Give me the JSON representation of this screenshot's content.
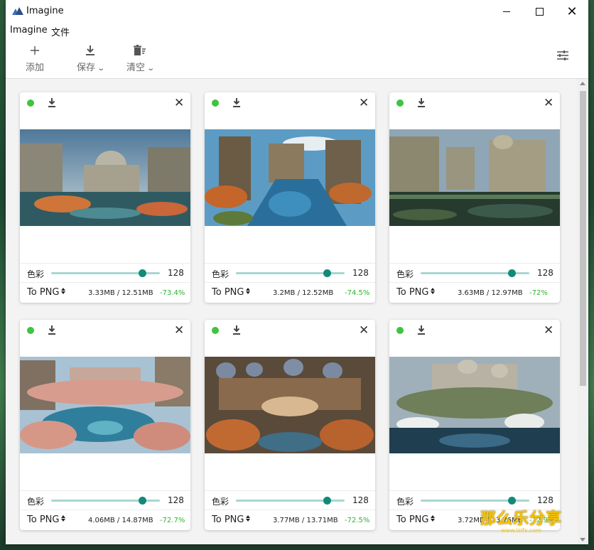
{
  "window": {
    "title": "Imagine"
  },
  "menu": [
    "Imagine",
    "文件"
  ],
  "toolbar": {
    "add_label": "添加",
    "save_label": "保存",
    "clear_label": "清空",
    "icons": {
      "add": "plus-icon",
      "save": "download-icon",
      "clear": "delete-list-icon",
      "settings": "sliders-icon"
    }
  },
  "colors": {
    "accent": "#128a78",
    "slider_track": "#a8d6d0",
    "status_dot": "#3ec43e",
    "saving": "#2fb52f"
  },
  "cards": [
    {
      "quality_label": "色彩",
      "quality_value": "128",
      "format": "To PNG",
      "size": "3.33MB / 12.51MB",
      "saving": "-73.4%",
      "slider_fraction": 0.84
    },
    {
      "quality_label": "色彩",
      "quality_value": "128",
      "format": "To PNG",
      "size": "3.2MB / 12.52MB",
      "saving": "-74.5%",
      "slider_fraction": 0.84
    },
    {
      "quality_label": "色彩",
      "quality_value": "128",
      "format": "To PNG",
      "size": "3.63MB / 12.97MB",
      "saving": "-72%",
      "slider_fraction": 0.84
    },
    {
      "quality_label": "色彩",
      "quality_value": "128",
      "format": "To PNG",
      "size": "4.06MB / 14.87MB",
      "saving": "-72.7%",
      "slider_fraction": 0.84
    },
    {
      "quality_label": "色彩",
      "quality_value": "128",
      "format": "To PNG",
      "size": "3.77MB / 13.71MB",
      "saving": "-72.5%",
      "slider_fraction": 0.84
    },
    {
      "quality_label": "色彩",
      "quality_value": "128",
      "format": "To PNG",
      "size": "3.72MB / 13.76MB",
      "saving": "-72.9%",
      "slider_fraction": 0.84
    }
  ],
  "watermark": {
    "text": "那么乐分享",
    "url": "www.lzlfx.com"
  }
}
